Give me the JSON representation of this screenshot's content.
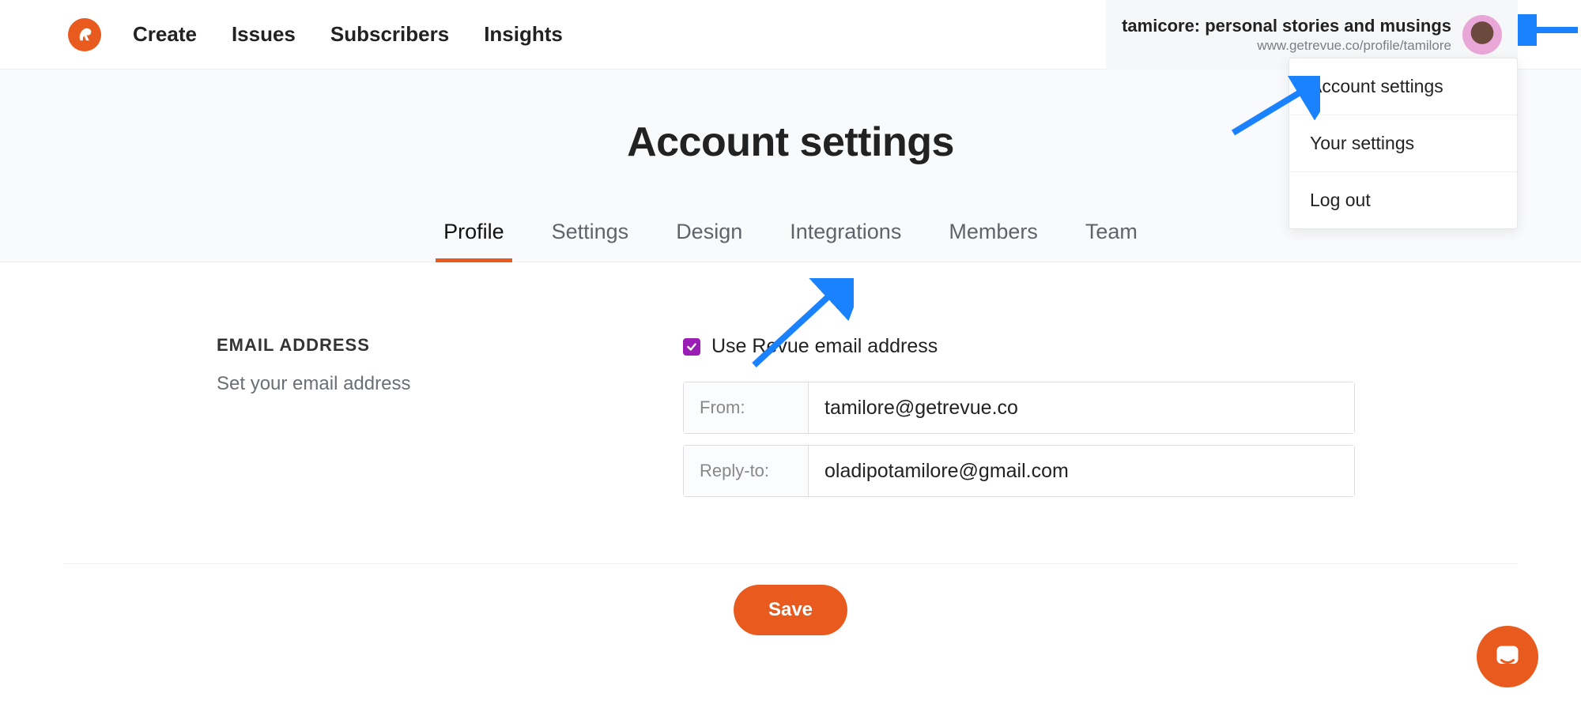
{
  "nav": {
    "items": [
      "Create",
      "Issues",
      "Subscribers",
      "Insights"
    ]
  },
  "profile": {
    "title": "tamicore: personal stories and musings",
    "url": "www.getrevue.co/profile/tamilore"
  },
  "menu": {
    "items": [
      "Account settings",
      "Your settings",
      "Log out"
    ]
  },
  "page": {
    "title": "Account settings"
  },
  "tabs": [
    "Profile",
    "Settings",
    "Design",
    "Integrations",
    "Members",
    "Team"
  ],
  "active_tab": 0,
  "email_section": {
    "heading": "EMAIL ADDRESS",
    "sub": "Set your email address",
    "checkbox_label": "Use Revue email address",
    "from_label": "From:",
    "from_value": "tamilore@getrevue.co",
    "replyto_label": "Reply-to:",
    "replyto_value": "oladipotamilore@gmail.com"
  },
  "buttons": {
    "save": "Save"
  },
  "icons": {
    "logo": "revue-logo",
    "intercom": "chat-bubble-icon"
  },
  "colors": {
    "accent": "#e85a1d",
    "checkbox": "#9a1db6",
    "annotation": "#1a82ff"
  }
}
